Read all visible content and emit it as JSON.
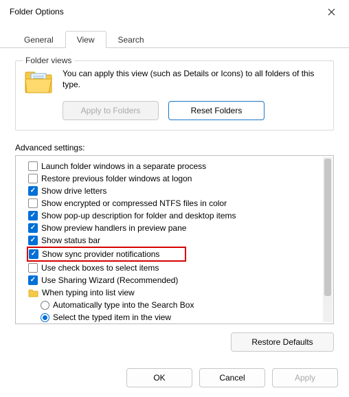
{
  "window": {
    "title": "Folder Options"
  },
  "tabs": {
    "general": "General",
    "view": "View",
    "search": "Search"
  },
  "folder_views": {
    "label": "Folder views",
    "text": "You can apply this view (such as Details or Icons) to all folders of this type.",
    "apply": "Apply to Folders",
    "reset": "Reset Folders"
  },
  "advanced": {
    "label": "Advanced settings:",
    "items": [
      {
        "kind": "check",
        "checked": false,
        "label": "Launch folder windows in a separate process"
      },
      {
        "kind": "check",
        "checked": false,
        "label": "Restore previous folder windows at logon"
      },
      {
        "kind": "check",
        "checked": true,
        "label": "Show drive letters"
      },
      {
        "kind": "check",
        "checked": false,
        "label": "Show encrypted or compressed NTFS files in color"
      },
      {
        "kind": "check",
        "checked": true,
        "label": "Show pop-up description for folder and desktop items"
      },
      {
        "kind": "check",
        "checked": true,
        "label": "Show preview handlers in preview pane"
      },
      {
        "kind": "check",
        "checked": true,
        "label": "Show status bar"
      },
      {
        "kind": "check",
        "checked": true,
        "label": "Show sync provider notifications",
        "highlight": true
      },
      {
        "kind": "check",
        "checked": false,
        "label": "Use check boxes to select items"
      },
      {
        "kind": "check",
        "checked": true,
        "label": "Use Sharing Wizard (Recommended)"
      },
      {
        "kind": "folder",
        "label": "When typing into list view"
      },
      {
        "kind": "radio",
        "selected": false,
        "label": "Automatically type into the Search Box"
      },
      {
        "kind": "radio",
        "selected": true,
        "label": "Select the typed item in the view"
      }
    ]
  },
  "restore_defaults": "Restore Defaults",
  "buttons": {
    "ok": "OK",
    "cancel": "Cancel",
    "apply": "Apply"
  }
}
